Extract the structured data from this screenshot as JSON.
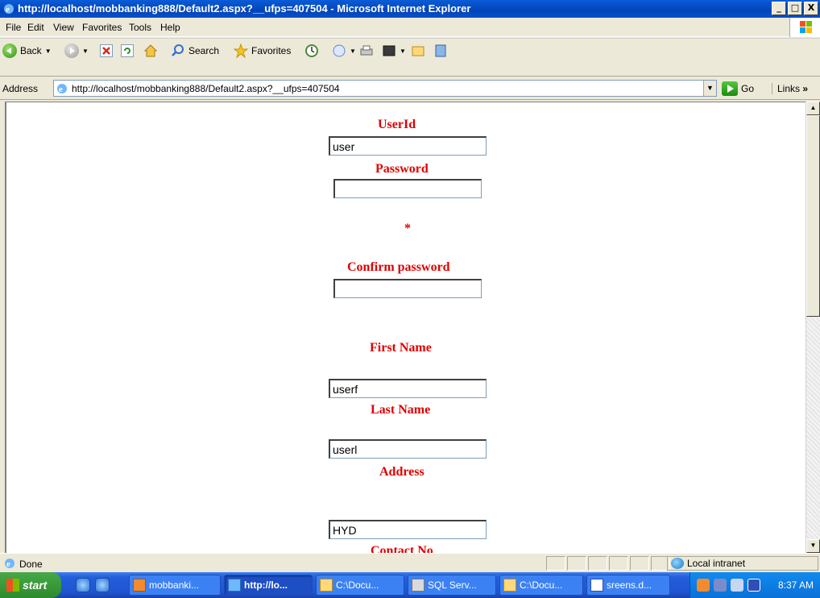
{
  "window": {
    "title": "http://localhost/mobbanking888/Default2.aspx?__ufps=407504 - Microsoft Internet Explorer",
    "buttons": {
      "minimize": "_",
      "maximize": "□",
      "close": "X"
    }
  },
  "menu": {
    "items": [
      "File",
      "Edit",
      "View",
      "Favorites",
      "Tools",
      "Help"
    ]
  },
  "toolbar": {
    "back": "Back",
    "search": "Search",
    "favorites": "Favorites"
  },
  "address": {
    "label": "Address",
    "url": "http://localhost/mobbanking888/Default2.aspx?__ufps=407504",
    "go": "Go",
    "links": "Links"
  },
  "form": {
    "userid_label": "UserId",
    "userid_value": "user",
    "password_label": "Password",
    "password_value": "",
    "required_marker": "*",
    "confirm_label": "Confirm password",
    "confirm_value": "",
    "firstname_label": "First Name",
    "firstname_value": "userf",
    "lastname_label": "Last Name",
    "lastname_value": "userl",
    "address_label": "Address",
    "address_value": "HYD",
    "contact_label": "Contact No"
  },
  "status": {
    "text": "Done",
    "zone": "Local intranet"
  },
  "taskbar": {
    "start": "start",
    "tasks": [
      "mobbanki...",
      "http://lo...",
      "C:\\Docu...",
      "SQL Serv...",
      "C:\\Docu...",
      "sreens.d..."
    ],
    "clock": "8:37 AM"
  },
  "colors": {
    "label_red": "#e00000",
    "title_blue": "#0a5cd6"
  }
}
